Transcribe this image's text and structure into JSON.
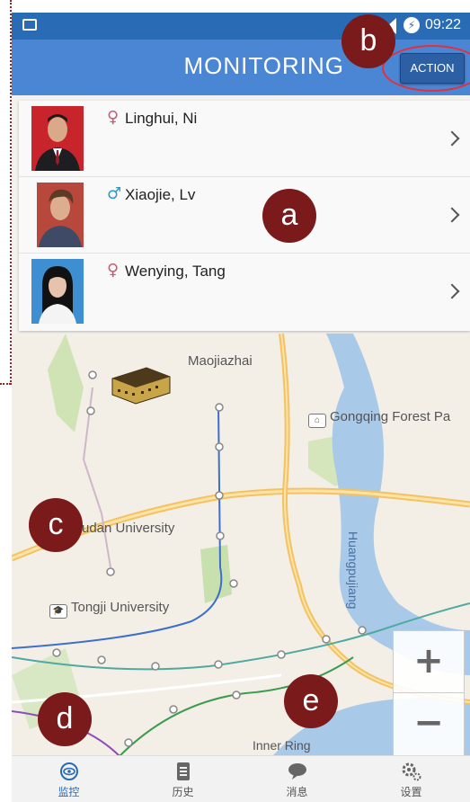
{
  "statusbar": {
    "time": "09:22"
  },
  "appbar": {
    "title": "MONITORING",
    "action_label": "ACTION"
  },
  "people": [
    {
      "name": "Linghui, Ni",
      "gender_symbol": "♀",
      "gender": "female"
    },
    {
      "name": "Xiaojie, Lv",
      "gender_symbol": "♂",
      "gender": "male"
    },
    {
      "name": "Wenying, Tang",
      "gender_symbol": "♀",
      "gender": "female"
    }
  ],
  "map": {
    "labels": {
      "maojiazhai": "Maojiazhai",
      "gongqing": "Gongqing Forest Pa",
      "fudan": "udan University",
      "tongji": "Tongji University",
      "river": "Huangpujiang",
      "inner_ring": "Inner Ring"
    },
    "zoom_in": "+",
    "zoom_out": "−"
  },
  "tabs": [
    {
      "label": "监控",
      "icon": "eye-icon",
      "active": true
    },
    {
      "label": "历史",
      "icon": "document-icon",
      "active": false
    },
    {
      "label": "消息",
      "icon": "chat-icon",
      "active": false
    },
    {
      "label": "设置",
      "icon": "gears-icon",
      "active": false
    }
  ],
  "annotations": {
    "a": "a",
    "b": "b",
    "c": "c",
    "d": "d",
    "e": "e"
  },
  "colors": {
    "statusbar": "#2a6bb5",
    "appbar": "#4a86d4",
    "badge": "#7a1a1a",
    "highlight": "#e0313d"
  }
}
